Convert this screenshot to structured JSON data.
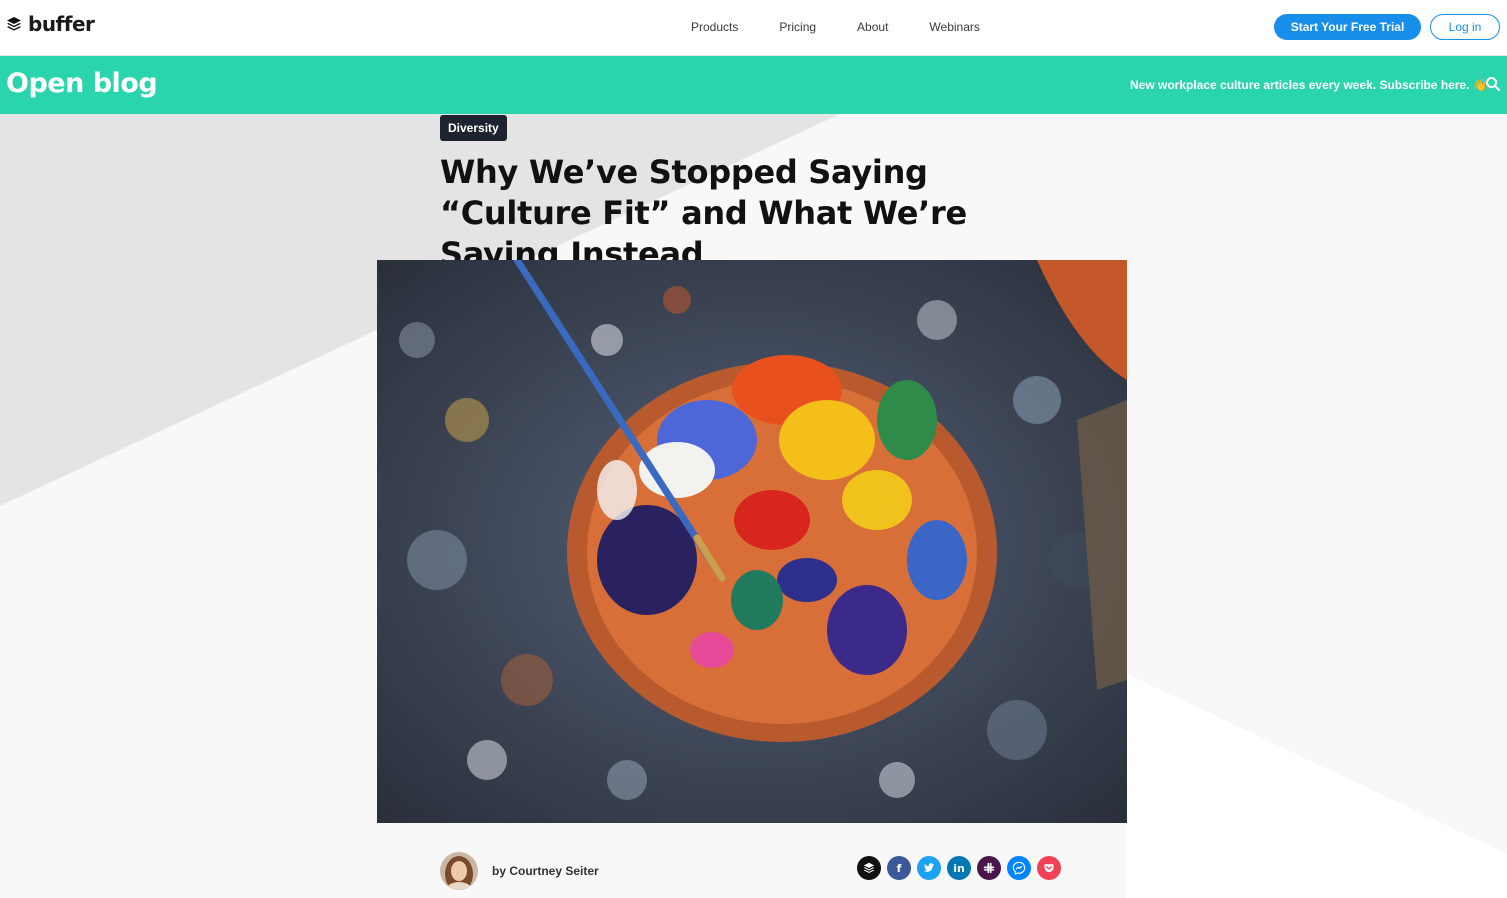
{
  "topnav": {
    "logo_text": "buffer",
    "links": [
      "Products",
      "Pricing",
      "About",
      "Webinars"
    ],
    "trial_label": "Start Your Free Trial",
    "login_label": "Log in"
  },
  "blogbar": {
    "title": "Open blog",
    "promo": "New workplace culture articles every week. Subscribe here. 👋"
  },
  "article": {
    "tag": "Diversity",
    "headline": "Why We’ve Stopped Saying “Culture Fit” and What We’re Saying Instead",
    "byline": "by Courtney Seiter"
  },
  "share_buttons": [
    {
      "icon": "buffer-icon",
      "color": "#111111"
    },
    {
      "icon": "facebook-icon",
      "glyph": "f",
      "color": "#3b5998"
    },
    {
      "icon": "twitter-icon",
      "color": "#1da1f2"
    },
    {
      "icon": "linkedin-icon",
      "glyph": "in",
      "color": "#0077b5"
    },
    {
      "icon": "slack-icon",
      "color": "#4a154b"
    },
    {
      "icon": "messenger-icon",
      "color": "#0084ff"
    },
    {
      "icon": "pocket-icon",
      "color": "#ef4056"
    }
  ],
  "colors": {
    "accent_green": "#2ad4ad",
    "brand_blue": "#168eea",
    "tag_bg": "#1d2430"
  }
}
